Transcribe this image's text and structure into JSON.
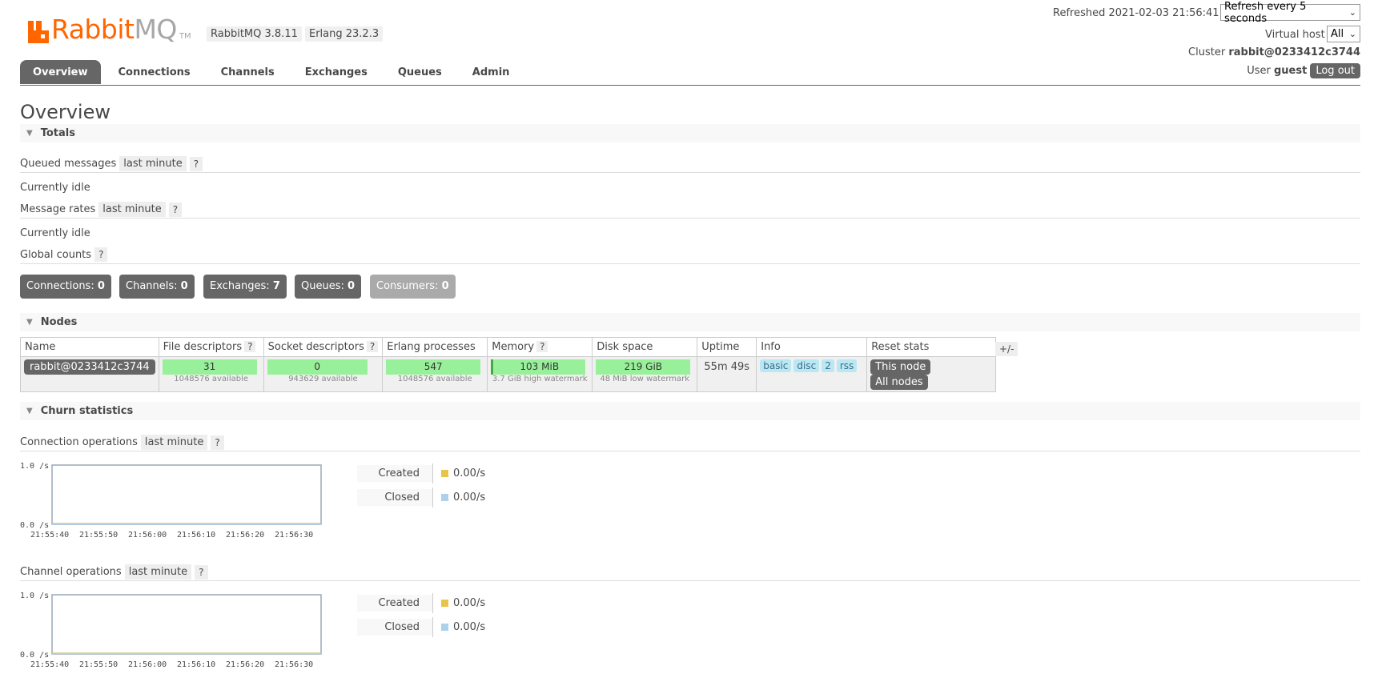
{
  "header": {
    "logo_rabbit": "Rabbit",
    "logo_mq": "MQ",
    "logo_tm": "TM",
    "rabbitmq_version": "RabbitMQ 3.8.11",
    "erlang_version": "Erlang 23.2.3",
    "refreshed": "Refreshed 2021-02-03 21:56:41",
    "refresh_option": "Refresh every 5 seconds",
    "virtual_host_label": "Virtual host",
    "virtual_host_value": "All",
    "cluster_label": "Cluster",
    "cluster_value": "rabbit@0233412c3744",
    "user_label": "User",
    "user_value": "guest",
    "logout_label": "Log out",
    "brand_color": "#ff6600"
  },
  "tabs": [
    {
      "label": "Overview",
      "active": true
    },
    {
      "label": "Connections"
    },
    {
      "label": "Channels"
    },
    {
      "label": "Exchanges"
    },
    {
      "label": "Queues"
    },
    {
      "label": "Admin"
    }
  ],
  "page_title": "Overview",
  "totals": {
    "title": "Totals",
    "queued_messages_label": "Queued messages",
    "queued_range": "last minute",
    "help": "?",
    "queued_status": "Currently idle",
    "message_rates_label": "Message rates",
    "rates_range": "last minute",
    "rates_status": "Currently idle",
    "global_counts_label": "Global counts",
    "counts": [
      {
        "label": "Connections:",
        "value": "0"
      },
      {
        "label": "Channels:",
        "value": "0"
      },
      {
        "label": "Exchanges:",
        "value": "7"
      },
      {
        "label": "Queues:",
        "value": "0"
      },
      {
        "label": "Consumers:",
        "value": "0"
      }
    ]
  },
  "nodes": {
    "title": "Nodes",
    "columns": [
      "Name",
      "File descriptors",
      "Socket descriptors",
      "Erlang processes",
      "Memory",
      "Disk space",
      "Uptime",
      "Info",
      "Reset stats"
    ],
    "plus_minus": "+/-",
    "row": {
      "name": "rabbit@0233412c3744",
      "file_descriptors": "31",
      "file_descriptors_sub": "1048576 available",
      "socket_descriptors": "0",
      "socket_descriptors_sub": "943629 available",
      "erlang_processes": "547",
      "erlang_processes_sub": "1048576 available",
      "memory": "103 MiB",
      "memory_sub": "3.7 GiB high watermark",
      "disk_space": "219 GiB",
      "disk_space_sub": "48 MiB low watermark",
      "uptime": "55m 49s",
      "info": [
        "basic",
        "disc",
        "2",
        "rss"
      ],
      "reset_this": "This node",
      "reset_all": "All nodes"
    }
  },
  "churn": {
    "title": "Churn statistics",
    "connection_label": "Connection operations",
    "channel_label": "Channel operations",
    "range": "last minute",
    "legend": [
      {
        "label": "Created",
        "value": "0.00/s",
        "color": "#e8c44b"
      },
      {
        "label": "Closed",
        "value": "0.00/s",
        "color": "#acd1ec"
      }
    ]
  },
  "chart_data": [
    {
      "type": "line",
      "title": "Connection operations",
      "x": [
        "21:55:40",
        "21:55:50",
        "21:56:00",
        "21:56:10",
        "21:56:20",
        "21:56:30"
      ],
      "y_ticks": [
        "1.0 /s",
        "0.0 /s"
      ],
      "ylim": [
        0,
        1
      ],
      "series": [
        {
          "name": "Created",
          "values": [
            0,
            0,
            0,
            0,
            0,
            0
          ]
        },
        {
          "name": "Closed",
          "values": [
            0,
            0,
            0,
            0,
            0,
            0
          ]
        }
      ]
    },
    {
      "type": "line",
      "title": "Channel operations",
      "x": [
        "21:55:40",
        "21:55:50",
        "21:56:00",
        "21:56:10",
        "21:56:20",
        "21:56:30"
      ],
      "y_ticks": [
        "1.0 /s",
        "0.0 /s"
      ],
      "ylim": [
        0,
        1
      ],
      "series": [
        {
          "name": "Created",
          "values": [
            0,
            0,
            0,
            0,
            0,
            0
          ]
        },
        {
          "name": "Closed",
          "values": [
            0,
            0,
            0,
            0,
            0,
            0
          ]
        }
      ]
    }
  ]
}
